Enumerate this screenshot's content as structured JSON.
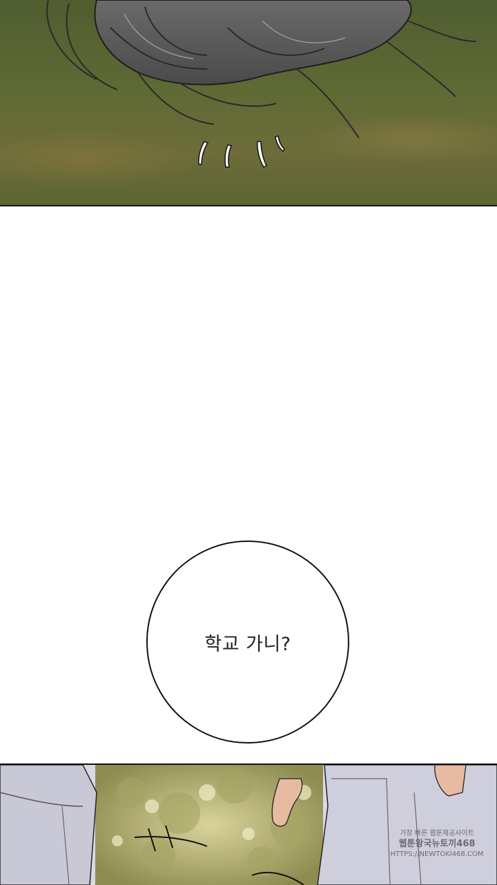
{
  "speech_bubble": {
    "text": "학교 가니?"
  },
  "watermark": {
    "line1": "가장 빠른 웹툰제공사이트",
    "line2": "웹툰왕국뉴토끼468",
    "line3": "HTTPS://NEWTOKI468.COM"
  }
}
